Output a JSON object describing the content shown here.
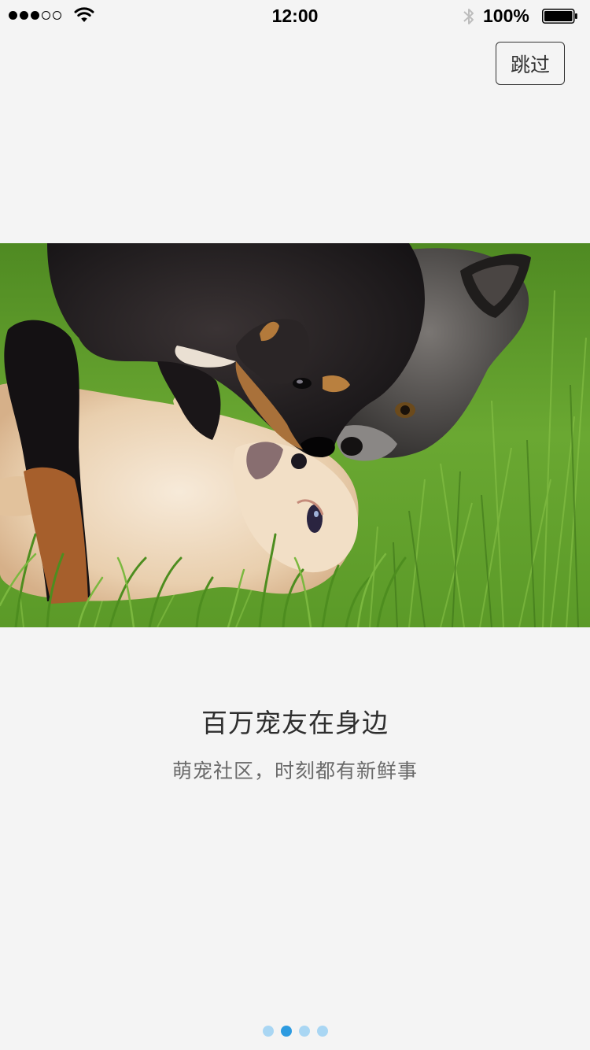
{
  "status_bar": {
    "time": "12:00",
    "battery_percent": "100%",
    "signal_bars_filled": 3,
    "signal_bars_total": 5
  },
  "skip_label": "跳过",
  "hero_image": {
    "icon": "dogs-playing-on-grass-photo"
  },
  "title": "百万宠友在身边",
  "subtitle": "萌宠社区，时刻都有新鲜事",
  "pager": {
    "total": 4,
    "active_index": 1
  },
  "colors": {
    "background": "#f4f4f4",
    "pager_active": "#2d9be0",
    "pager_inactive": "#a9d6f3",
    "grass": "#5f9b2c",
    "title": "#2e2e2e",
    "subtitle": "#6a6a6a"
  }
}
